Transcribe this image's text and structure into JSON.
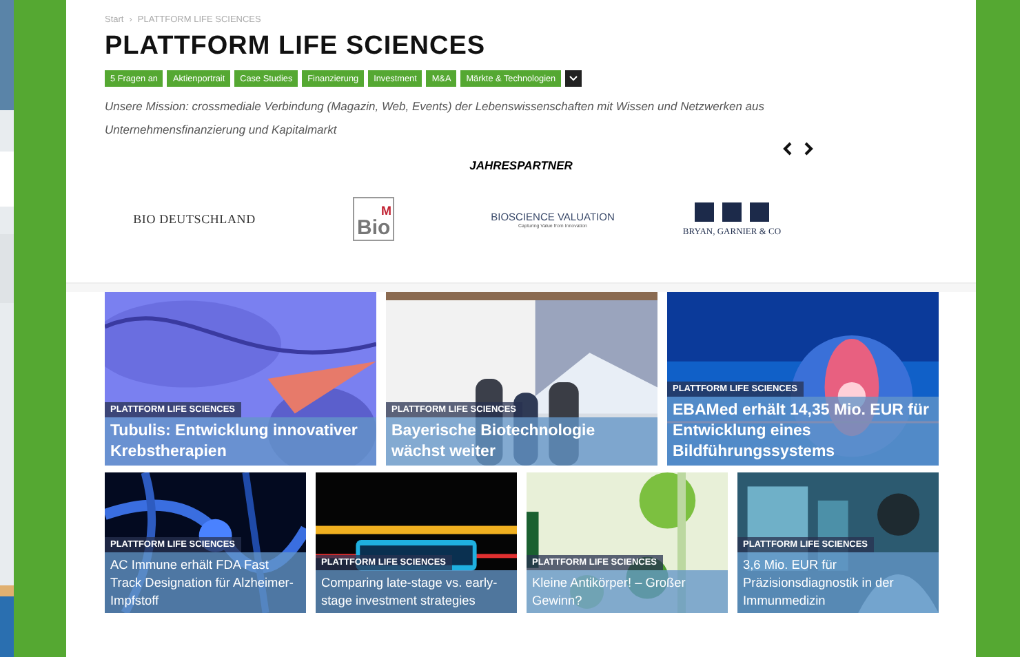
{
  "breadcrumb": [
    "Start",
    "›",
    "PLATTFORM LIFE SCIENCES"
  ],
  "title": "PLATTFORM LIFE SCIENCES",
  "tags": [
    "5 Fragen an",
    "Aktienportrait",
    "Case Studies",
    "Finanzierung",
    "Investment",
    "M&A",
    "Märkte & Technologien"
  ],
  "mission": "Unsere Mission: crossmediale Verbindung (Magazin, Web, Events) der Lebenswissenschaften mit Wissen und Netzwerken aus Unternehmensfinanzierung und Kapitalmarkt",
  "partners": {
    "heading": "JAHRESPARTNER",
    "logos": [
      {
        "kind": "wordmark",
        "text": "BIO DEUTSCHLAND"
      },
      {
        "kind": "boxed",
        "text": "Bio",
        "sup": "M"
      },
      {
        "kind": "tagline",
        "text": "BIOSCIENCE VALUATION",
        "sub": "Capturing Value from Innovation"
      },
      {
        "kind": "squares",
        "text": "BRYAN, GARNIER & CO"
      }
    ]
  },
  "featured": [
    {
      "category": "PLATTFORM LIFE SCIENCES",
      "headline": "Tubulis: Entwicklung innovativer Krebstherapien"
    },
    {
      "category": "PLATTFORM LIFE SCIENCES",
      "headline": "Bayerische Biotechnologie wächst weiter"
    },
    {
      "category": "PLATTFORM LIFE SCIENCES",
      "headline": "EBAMed erhält 14,35 Mio. EUR für Entwicklung eines Bildführungssystems"
    }
  ],
  "articles": [
    {
      "category": "PLATTFORM LIFE SCIENCES",
      "headline": "AC Immune erhält FDA Fast Track Designation für Alzheimer-Impfstoff"
    },
    {
      "category": "PLATTFORM LIFE SCIENCES",
      "headline": "Comparing late-stage vs. early-stage investment strategies"
    },
    {
      "category": "PLATTFORM LIFE SCIENCES",
      "headline": "Kleine Antikörper! – Großer Gewinn?"
    },
    {
      "category": "PLATTFORM LIFE SCIENCES",
      "headline": "3,6 Mio. EUR für Präzisionsdiagnostik in der Immunmedizin"
    }
  ]
}
